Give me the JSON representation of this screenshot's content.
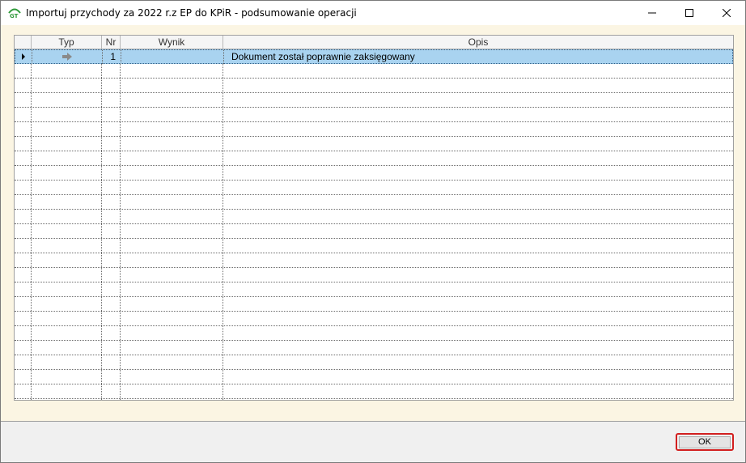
{
  "window": {
    "title": "Importuj przychody za 2022 r.z EP do KPiR - podsumowanie operacji"
  },
  "colors": {
    "content_background": "#fbf5e3",
    "selected_row": "#a9d3f0",
    "ok_highlight": "#d21f1f",
    "app_icon": "#2f9a3a"
  },
  "grid": {
    "columns": [
      {
        "key": "typ",
        "label": "Typ"
      },
      {
        "key": "nr",
        "label": "Nr"
      },
      {
        "key": "wynik",
        "label": "Wynik"
      },
      {
        "key": "opis",
        "label": "Opis"
      }
    ],
    "rows": [
      {
        "typ_icon": "arrow-right-icon",
        "nr": "1",
        "wynik": "",
        "opis": "Dokument został poprawnie zaksięgowany",
        "selected": true
      }
    ],
    "empty_row_count": 24
  },
  "footer": {
    "ok_label": "OK"
  }
}
